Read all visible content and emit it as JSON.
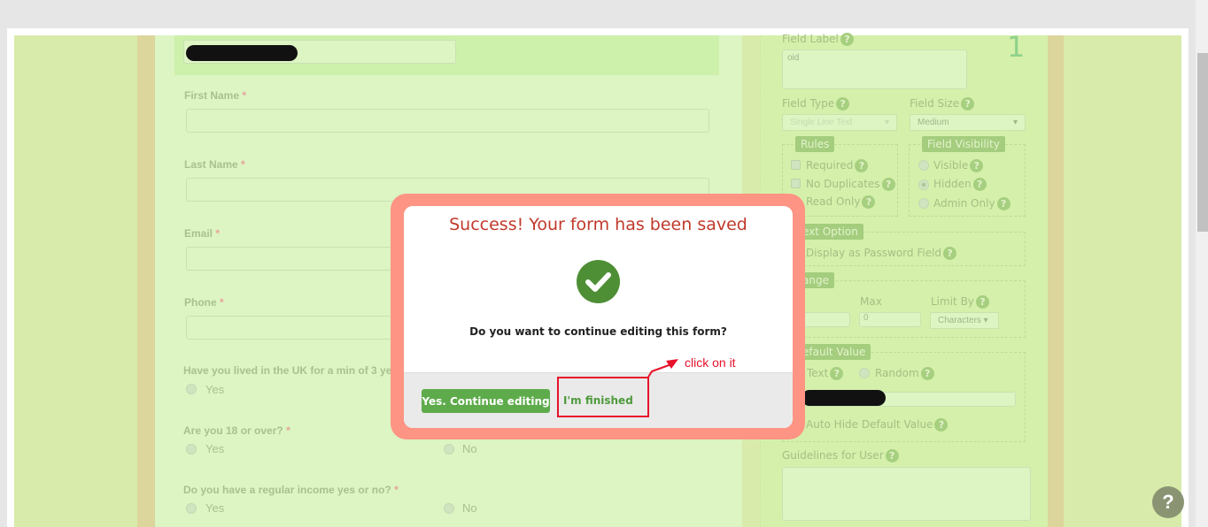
{
  "form": {
    "fields": [
      {
        "label": "First Name",
        "required": "*"
      },
      {
        "label": "Last Name",
        "required": "*"
      },
      {
        "label": "Email",
        "required": "*"
      },
      {
        "label": "Phone",
        "required": "*"
      }
    ],
    "questions": [
      {
        "label": "Have you lived in the UK for a min of 3 ye",
        "options": [
          "Yes"
        ]
      },
      {
        "label": "Are you 18 or over?",
        "required": "*",
        "options": [
          "Yes",
          "No"
        ]
      },
      {
        "label": "Do you have a regular income yes or no?",
        "required": "*",
        "options": [
          "Yes",
          "No"
        ]
      }
    ]
  },
  "panel": {
    "number": "1",
    "field_label": "Field Label",
    "field_label_value": "oid",
    "field_type": "Field Type",
    "field_type_value": "Single Line Text",
    "field_size": "Field Size",
    "field_size_value": "Medium",
    "rules": "Rules",
    "rules_items": [
      "Required",
      "No Duplicates",
      "Read Only"
    ],
    "visibility": "Field Visibility",
    "visibility_items": [
      "Visible",
      "Hidden",
      "Admin Only"
    ],
    "text_option": "ext Option",
    "password": "Display as Password Field",
    "range": "ange",
    "max": "Max",
    "max_value": "0",
    "limit_by": "Limit By",
    "limit_value": "Characters",
    "default_value": "efault Value",
    "dv_text": "Text",
    "dv_random": "Random",
    "auto_hide": "Auto Hide Default Value",
    "guidelines": "Guidelines for User",
    "help_glyph": "?"
  },
  "dialog": {
    "title": "Success! Your form has been saved",
    "question": "Do you want to continue editing this form?",
    "continue": "Yes. Continue editing",
    "finished": "I'm finished"
  },
  "annotation": {
    "text": "click on it",
    "color": "#e8112b"
  },
  "help_button": "?",
  "colors": {
    "success_title": "#c0392b",
    "button": "#5eab4b",
    "check": "#4e8f36",
    "frame": "#fe9483"
  }
}
